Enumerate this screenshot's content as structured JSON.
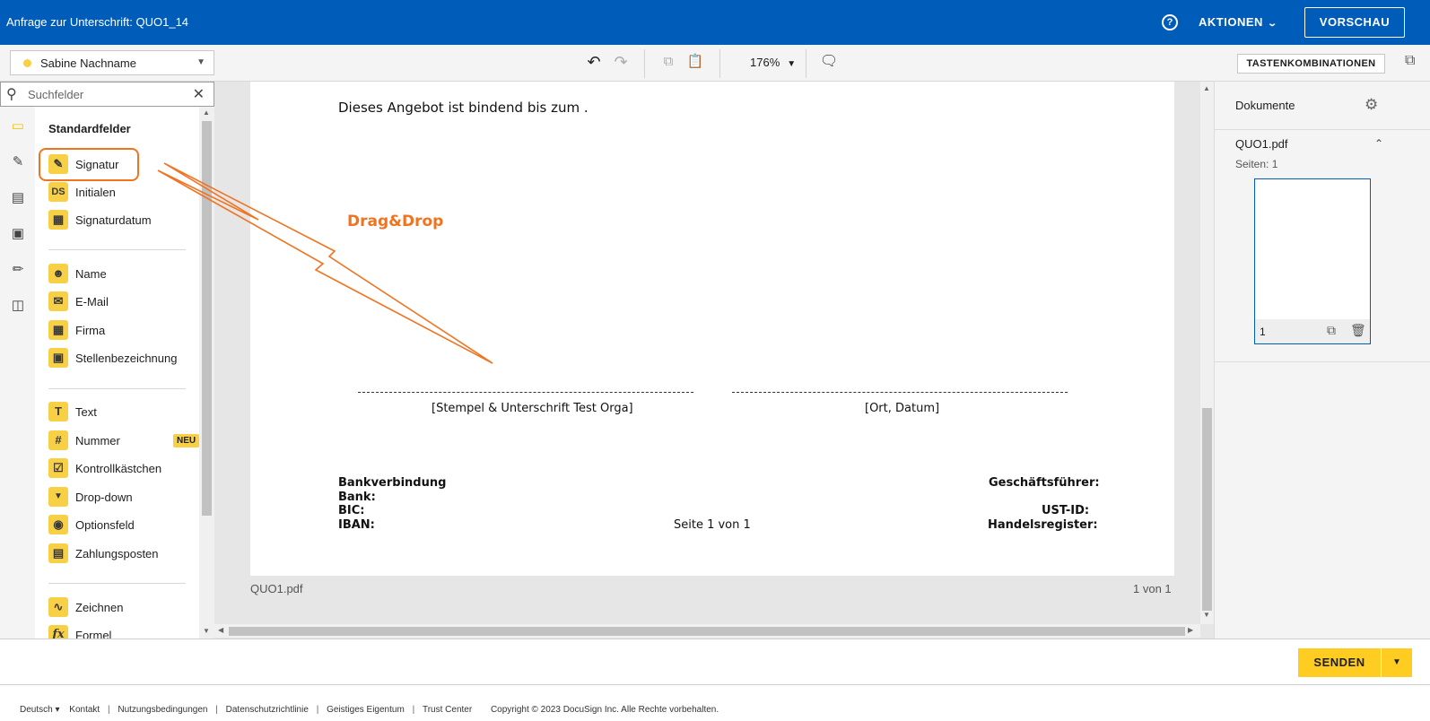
{
  "header": {
    "title": "Anfrage zur Unterschrift: QUO1_14",
    "help_icon": "help-circle-icon",
    "actions_label": "AKTIONEN",
    "preview_label": "VORSCHAU"
  },
  "toolbar": {
    "recipient": "Sabine Nachname",
    "recipient_color": "#f7d046",
    "zoom": "176%",
    "shortcuts_label": "TASTENKOMBINATIONEN"
  },
  "search": {
    "placeholder": "Suchfelder"
  },
  "fields": {
    "heading": "Standardfelder",
    "group1": [
      {
        "label": "Signatur",
        "icon": "pen-icon"
      },
      {
        "label": "Initialen",
        "icon": "initials-icon"
      },
      {
        "label": "Signaturdatum",
        "icon": "calendar-icon"
      }
    ],
    "group2": [
      {
        "label": "Name",
        "icon": "person-icon"
      },
      {
        "label": "E-Mail",
        "icon": "envelope-icon"
      },
      {
        "label": "Firma",
        "icon": "building-icon"
      },
      {
        "label": "Stellenbezeichnung",
        "icon": "briefcase-icon"
      }
    ],
    "group3": [
      {
        "label": "Text",
        "icon": "text-icon"
      },
      {
        "label": "Nummer",
        "icon": "hash-icon",
        "badge": "NEU"
      },
      {
        "label": "Kontrollkästchen",
        "icon": "checkbox-icon"
      },
      {
        "label": "Drop-down",
        "icon": "dropdown-icon"
      },
      {
        "label": "Optionsfeld",
        "icon": "radio-icon"
      },
      {
        "label": "Zahlungsposten",
        "icon": "payment-icon"
      }
    ],
    "group4": [
      {
        "label": "Zeichnen",
        "icon": "draw-icon"
      },
      {
        "label": "Formel",
        "icon": "formula-icon"
      }
    ],
    "initials_glyph": "DS",
    "text_glyph": "T",
    "hash_glyph": "#",
    "formula_glyph": "fx"
  },
  "document": {
    "line1": "Dieses Angebot ist bindend bis zum .",
    "annotation": "Drag&Drop",
    "caption_left": "[Stempel & Unterschrift Test Orga]",
    "caption_right": "[Ort, Datum]",
    "bank_heading": "Bankverbindung",
    "bank": "Bank:",
    "bic": "BIC:",
    "iban": "IBAN:",
    "page_label": "Seite 1 von 1",
    "ceo": "Geschäftsführer:",
    "ust": "UST-ID:",
    "register": "Handelsregister:",
    "file_name": "QUO1.pdf",
    "page_count": "1 von 1"
  },
  "right_panel": {
    "title": "Dokumente",
    "file_name": "QUO1.pdf",
    "pages_label": "Seiten: 1",
    "thumb_page": "1"
  },
  "action_bar": {
    "send_label": "SENDEN"
  },
  "footer": {
    "language": "Deutsch",
    "links": [
      "Kontakt",
      "Nutzungsbedingungen",
      "Datenschutzrichtlinie",
      "Geistiges Eigentum",
      "Trust Center"
    ],
    "copyright": "Copyright © 2023 DocuSign Inc. Alle Rechte vorbehalten."
  },
  "colors": {
    "brand_blue": "#005cb9",
    "field_yellow": "#f7d046",
    "annotation_orange": "#f07320",
    "send_yellow": "#ffcc22"
  }
}
